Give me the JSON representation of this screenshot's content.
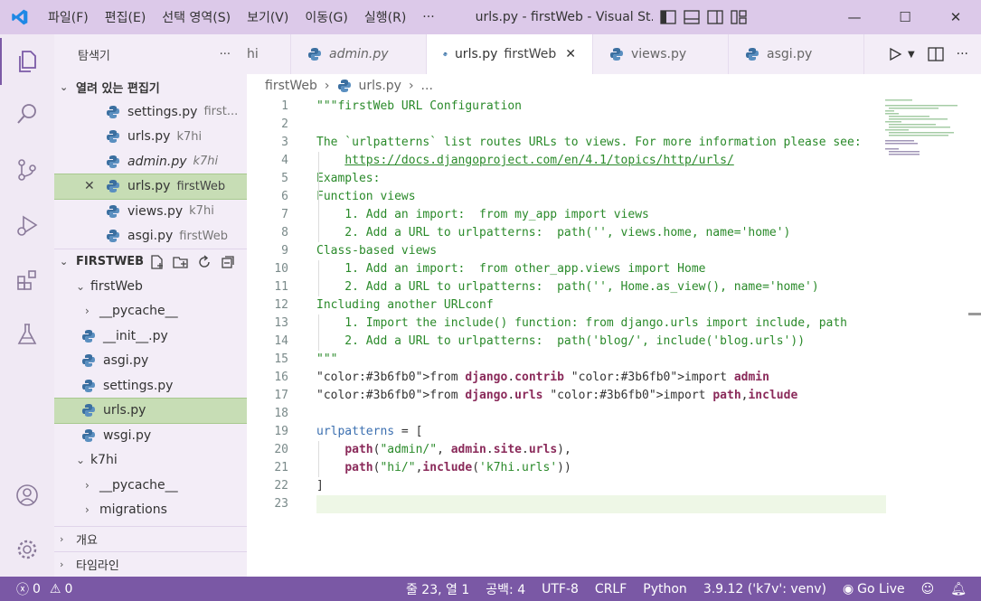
{
  "titlebar": {
    "menu": [
      "파일(F)",
      "편집(E)",
      "선택 영역(S)",
      "보기(V)",
      "이동(G)",
      "실행(R)",
      "···"
    ],
    "title": "urls.py - firstWeb - Visual St..."
  },
  "sidebar": {
    "header": "탐색기",
    "open_editors": {
      "title": "열려 있는 편집기",
      "items": [
        {
          "name": "settings.py",
          "folder": "first..."
        },
        {
          "name": "urls.py",
          "folder": "k7hi"
        },
        {
          "name": "admin.py",
          "folder": "k7hi"
        },
        {
          "name": "urls.py",
          "folder": "firstWeb"
        },
        {
          "name": "views.py",
          "folder": "k7hi"
        },
        {
          "name": "asgi.py",
          "folder": "firstWeb"
        }
      ]
    },
    "workspace": {
      "title": "FIRSTWEB",
      "tree": [
        {
          "label": "firstWeb"
        },
        {
          "label": "__pycache__"
        },
        {
          "label": "__init__.py"
        },
        {
          "label": "asgi.py"
        },
        {
          "label": "settings.py"
        },
        {
          "label": "urls.py"
        },
        {
          "label": "wsgi.py"
        },
        {
          "label": "k7hi"
        },
        {
          "label": "__pycache__"
        },
        {
          "label": "migrations"
        }
      ]
    },
    "outline": "개요",
    "timeline": "타임라인"
  },
  "tabs": [
    {
      "label": "hi",
      "dim": ""
    },
    {
      "label": "admin.py",
      "dim": ""
    },
    {
      "label": "urls.py",
      "dim": "firstWeb"
    },
    {
      "label": "views.py",
      "dim": ""
    },
    {
      "label": "asgi.py",
      "dim": ""
    }
  ],
  "breadcrumb": {
    "folder": "firstWeb",
    "file": "urls.py",
    "more": "..."
  },
  "code": [
    "\"\"\"firstWeb URL Configuration",
    "",
    "The `urlpatterns` list routes URLs to views. For more information please see:",
    "    https://docs.djangoproject.com/en/4.1/topics/http/urls/",
    "Examples:",
    "Function views",
    "    1. Add an import:  from my_app import views",
    "    2. Add a URL to urlpatterns:  path('', views.home, name='home')",
    "Class-based views",
    "    1. Add an import:  from other_app.views import Home",
    "    2. Add a URL to urlpatterns:  path('', Home.as_view(), name='home')",
    "Including another URLconf",
    "    1. Import the include() function: from django.urls import include, path",
    "    2. Add a URL to urlpatterns:  path('blog/', include('blog.urls'))",
    "\"\"\"",
    "from django.contrib import admin",
    "from django.urls import path,include",
    "",
    "urlpatterns = [",
    "    path(\"admin/\", admin.site.urls),",
    "    path(\"hi/\",include('k7hi.urls'))",
    "]",
    ""
  ],
  "status": {
    "errors": "0",
    "warnings": "0",
    "position": "줄 23, 열 1",
    "spaces": "공백: 4",
    "encoding": "UTF-8",
    "eol": "CRLF",
    "language": "Python",
    "interpreter": "3.9.12 ('k7v': venv)",
    "golive": "Go Live"
  },
  "colors": {
    "accent": "#7a58a5",
    "titlebar": "#dcc9e9",
    "selection": "#c7ddb5"
  }
}
